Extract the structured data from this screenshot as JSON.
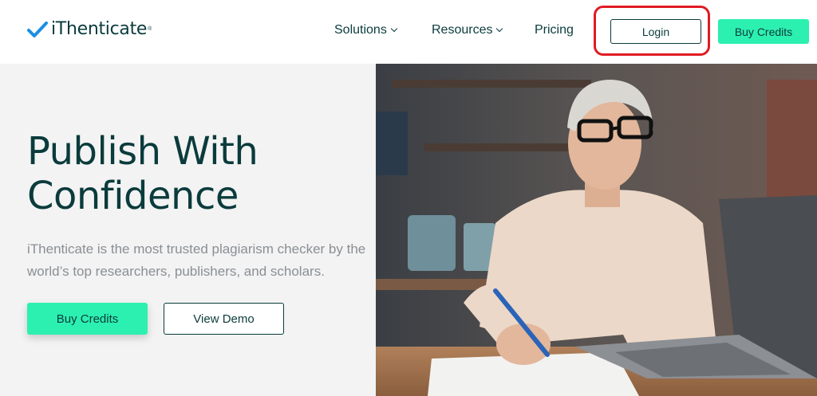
{
  "header": {
    "logo_text": "iThenticate",
    "logo_tm": "®",
    "nav": {
      "solutions": "Solutions",
      "resources": "Resources",
      "pricing": "Pricing"
    },
    "login_label": "Login",
    "buy_credits_label": "Buy Credits"
  },
  "hero": {
    "title_line1": "Publish With",
    "title_line2": "Confidence",
    "subtitle": "iThenticate is the most trusted plagiarism checker by the world’s top researchers, publishers, and scholars.",
    "buy_credits_label": "Buy Credits",
    "view_demo_label": "View Demo"
  },
  "colors": {
    "brand_dark": "#0b3b3c",
    "accent_green": "#2cf0b0",
    "highlight_red": "#e01b24",
    "check_blue": "#1a8fe3"
  },
  "icons": {
    "logo": "checkmark-icon",
    "dropdown": "chevron-down-icon"
  }
}
